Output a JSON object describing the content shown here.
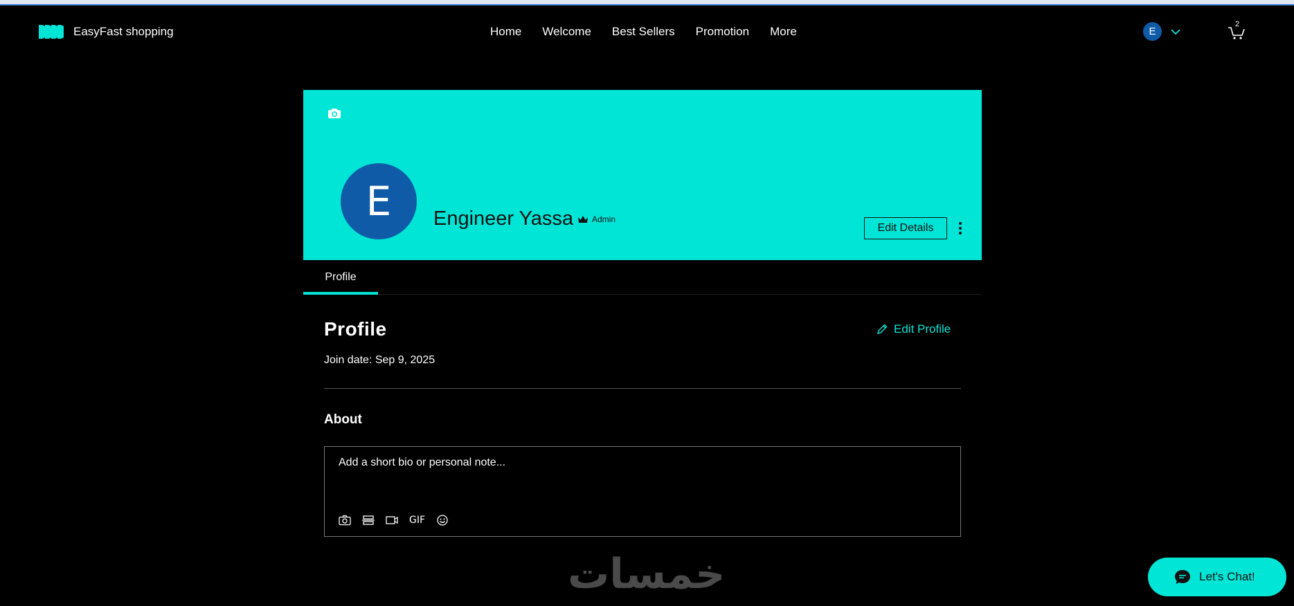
{
  "brand": {
    "name": "EasyFast shopping",
    "accent": "#00e5d6",
    "avatar_color": "#0f5ba8"
  },
  "nav": {
    "items": [
      "Home",
      "Welcome",
      "Best Sellers",
      "Promotion",
      "More"
    ]
  },
  "user_menu": {
    "initial": "E"
  },
  "cart": {
    "count": "2"
  },
  "cover": {
    "avatar_initial": "E",
    "name": "Engineer Yassa",
    "role": "Admin",
    "edit_details_label": "Edit Details"
  },
  "tabs": [
    {
      "label": "Profile",
      "active": true
    }
  ],
  "profile": {
    "title": "Profile",
    "edit_label": "Edit Profile",
    "join_date": "Join date: Sep 9, 2025"
  },
  "about": {
    "title": "About",
    "placeholder": "Add a short bio or personal note...",
    "toolbar": [
      "camera-icon",
      "divider-icon",
      "video-icon",
      "gif-icon",
      "emoji-icon"
    ],
    "gif_label": "GIF"
  },
  "watermark": "خمسات",
  "chat": {
    "label": "Let's Chat!"
  }
}
